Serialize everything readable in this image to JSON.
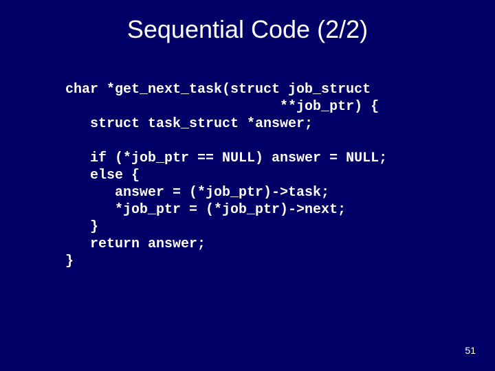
{
  "title": "Sequential Code (2/2)",
  "code": "char *get_next_task(struct job_struct\n                          **job_ptr) {\n   struct task_struct *answer;\n\n   if (*job_ptr == NULL) answer = NULL;\n   else {\n      answer = (*job_ptr)->task;\n      *job_ptr = (*job_ptr)->next;\n   }\n   return answer;\n}",
  "page_number": "51"
}
